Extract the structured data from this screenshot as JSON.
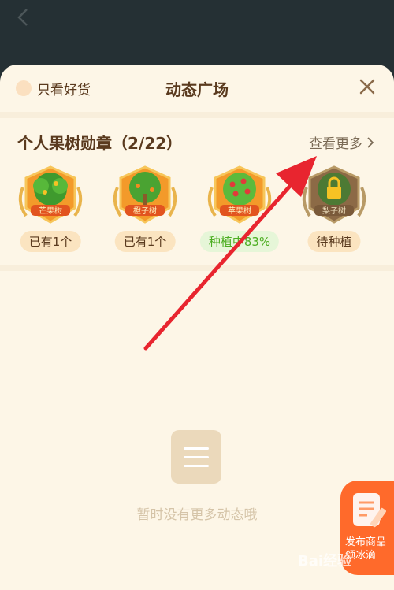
{
  "sheet": {
    "toggle_label": "只看好货",
    "title": "动态广场"
  },
  "badges_section": {
    "title": "个人果树勋章（2/22）",
    "more_label": "查看更多",
    "badges": [
      {
        "name": "芒果树",
        "status": "已有1个",
        "state": "owned"
      },
      {
        "name": "橙子树",
        "status": "已有1个",
        "state": "owned"
      },
      {
        "name": "苹果树",
        "status": "种植中83%",
        "state": "growing"
      },
      {
        "name": "梨子树",
        "status": "待种植",
        "state": "locked"
      }
    ]
  },
  "empty_state": {
    "message": "暂时没有更多动态哦"
  },
  "fab": {
    "label_line1": "发布商品",
    "label_line2": "领冰滴"
  },
  "watermark": "Bai经验",
  "colors": {
    "background_dark": "#253034",
    "sheet_bg": "#fdf6e7",
    "accent_orange": "#ff6a2b",
    "growing_green": "#4cae22",
    "annotation_arrow": "#e8252f"
  },
  "icons": {
    "back": "chevron-left-icon",
    "close": "close-icon",
    "more": "chevron-right-icon",
    "empty": "list-icon",
    "fab": "edit-note-icon",
    "locked_badge": "lock-icon"
  }
}
